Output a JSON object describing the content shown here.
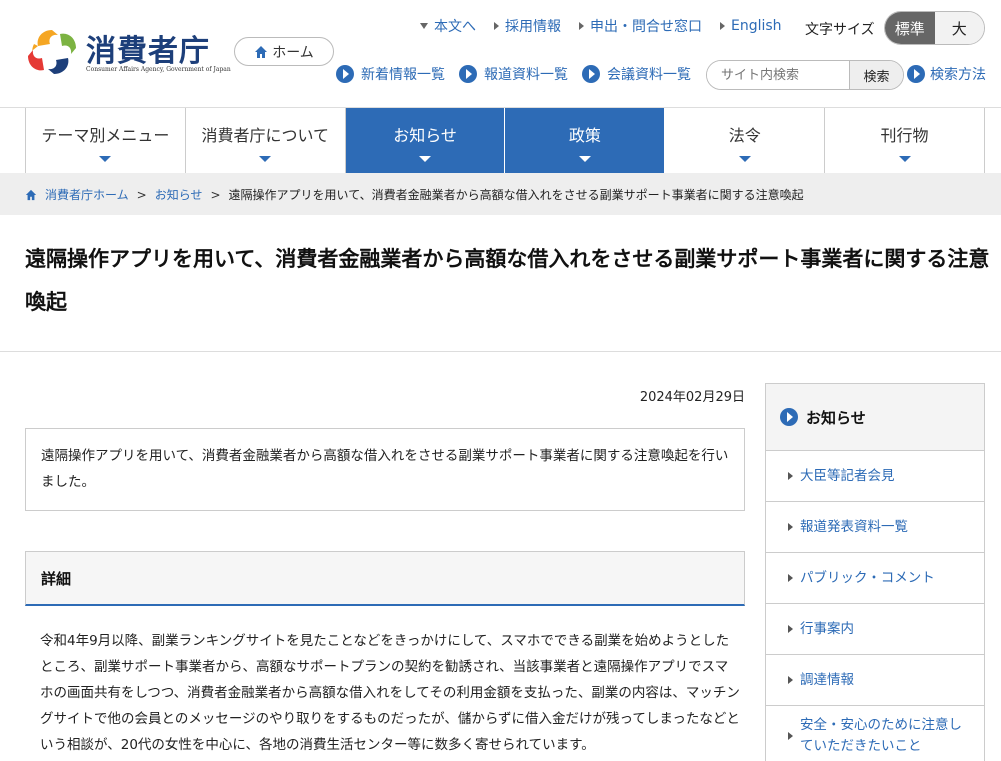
{
  "header": {
    "logo_text": "消費者庁",
    "logo_sub": "Consumer Affairs Agency, Government of Japan",
    "home_label": "ホーム",
    "toplinks": [
      "本文へ",
      "採用情報",
      "申出・問合せ窓口",
      "English"
    ],
    "fontsize_label": "文字サイズ",
    "fontsize_standard": "標準",
    "fontsize_large": "大",
    "sublinks": [
      "新着情報一覧",
      "報道資料一覧",
      "会議資料一覧"
    ],
    "search_placeholder": "サイト内検索",
    "search_button": "検索",
    "search_help": "検索方法"
  },
  "gnav": [
    {
      "label": "テーマ別メニュー",
      "active": false
    },
    {
      "label": "消費者庁について",
      "active": false
    },
    {
      "label": "お知らせ",
      "active": true
    },
    {
      "label": "政策",
      "active": true
    },
    {
      "label": "法令",
      "active": false
    },
    {
      "label": "刊行物",
      "active": false
    }
  ],
  "breadcrumb": {
    "home": "消費者庁ホーム",
    "sep": ">",
    "parent": "お知らせ",
    "current": "遠隔操作アプリを用いて、消費者金融業者から高額な借入れをさせる副業サポート事業者に関する注意喚起"
  },
  "page": {
    "title": "遠隔操作アプリを用いて、消費者金融業者から高額な借入れをさせる副業サポート事業者に関する注意喚起",
    "date": "2024年02月29日",
    "summary": "遠隔操作アプリを用いて、消費者金融業者から高額な借入れをさせる副業サポート事業者に関する注意喚起を行いました。",
    "detail_heading": "詳細",
    "body": "令和4年9月以降、副業ランキングサイトを見たことなどをきっかけにして、スマホでできる副業を始めようとしたところ、副業サポート事業者から、高額なサポートプランの契約を勧誘され、当該事業者と遠隔操作アプリでスマホの画面共有をしつつ、消費者金融業者から高額な借入れをしてその利用金額を支払った、副業の内容は、マッチングサイトで他の会員とのメッセージのやり取りをするものだったが、儲からずに借入金だけが残ってしまったなどという相談が、20代の女性を中心に、各地の消費生活センター等に数多く寄せられています。"
  },
  "sidebar": {
    "heading": "お知らせ",
    "items": [
      "大臣等記者会見",
      "報道発表資料一覧",
      "パブリック・コメント",
      "行事案内",
      "調達情報",
      "安全・安心のために注意していただきたいこと"
    ]
  },
  "colors": {
    "accent": "#2d6bb6",
    "logo_navy": "#1d3f7a"
  }
}
